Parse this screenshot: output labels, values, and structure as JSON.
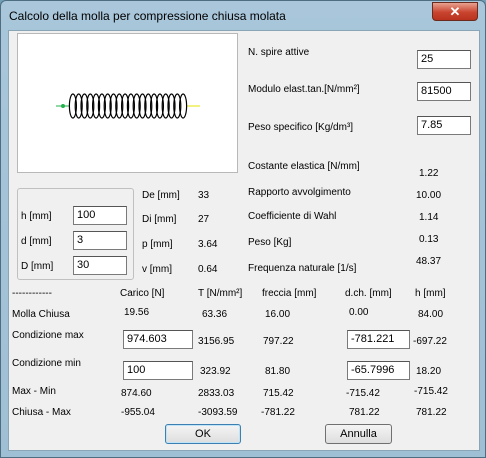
{
  "window": {
    "title": "Calcolo della molla per compressione chiusa molata",
    "close_glyph": "✕"
  },
  "params": {
    "spire": {
      "label": "N. spire attive",
      "value": "25"
    },
    "modulo": {
      "label": "Modulo elast.tan.[N/mm²]",
      "value": "81500"
    },
    "peso_spec": {
      "label": "Peso specifico [Kg/dm³]",
      "value": "7.85"
    }
  },
  "results": {
    "costante": {
      "label": "Costante elastica [N/mm]",
      "value": "1.22"
    },
    "rapporto": {
      "label": "Rapporto avvolgimento",
      "value": "10.00"
    },
    "wahl": {
      "label": "Coefficiente di Wahl",
      "value": "1.14"
    },
    "peso": {
      "label": "Peso [Kg]",
      "value": "0.13"
    },
    "frequenza": {
      "label": "Frequenza naturale [1/s]",
      "value": "48.37"
    }
  },
  "geometry": {
    "h": {
      "label": "h [mm]",
      "value": "100"
    },
    "d": {
      "label": "d [mm]",
      "value": "3"
    },
    "D": {
      "label": "D [mm]",
      "value": "30"
    }
  },
  "derived": {
    "De": {
      "label": "De [mm]",
      "value": "33"
    },
    "Di": {
      "label": "Di [mm]",
      "value": "27"
    },
    "p": {
      "label": "p [mm]",
      "value": "3.64"
    },
    "v": {
      "label": "v [mm]",
      "value": "0.64"
    }
  },
  "table": {
    "dashes": "------------",
    "headers": [
      "Carico [N]",
      "T [N/mm²]",
      "freccia [mm]",
      "d.ch. [mm]",
      "h [mm]"
    ],
    "rows": [
      {
        "label": "Molla   Chiusa",
        "carico": "19.56",
        "t": "63.36",
        "freccia": "16.00",
        "dch": "0.00",
        "h": "84.00"
      },
      {
        "label": "Condizione max",
        "carico": "974.603",
        "t": "3156.95",
        "freccia": "797.22",
        "dch": "-781.221",
        "h": "-697.22"
      },
      {
        "label": "Condizione min",
        "carico": "100",
        "t": "323.92",
        "freccia": "81.80",
        "dch": "-65.7996",
        "h": "18.20"
      },
      {
        "label": "Max   -   Min",
        "carico": "874.60",
        "t": "2833.03",
        "freccia": "715.42",
        "dch": "-715.42",
        "h": "-715.42"
      },
      {
        "label": "Chiusa  -  Max",
        "carico": "-955.04",
        "t": "-3093.59",
        "freccia": "-781.22",
        "dch": "781.22",
        "h": "781.22"
      }
    ]
  },
  "buttons": {
    "ok": "OK",
    "annulla": "Annulla"
  },
  "colors": {
    "spring_stroke": "#000000",
    "spring_end_left": "#22b14c",
    "spring_end_right": "#e6e600"
  },
  "icons": {
    "close": "close-icon"
  }
}
